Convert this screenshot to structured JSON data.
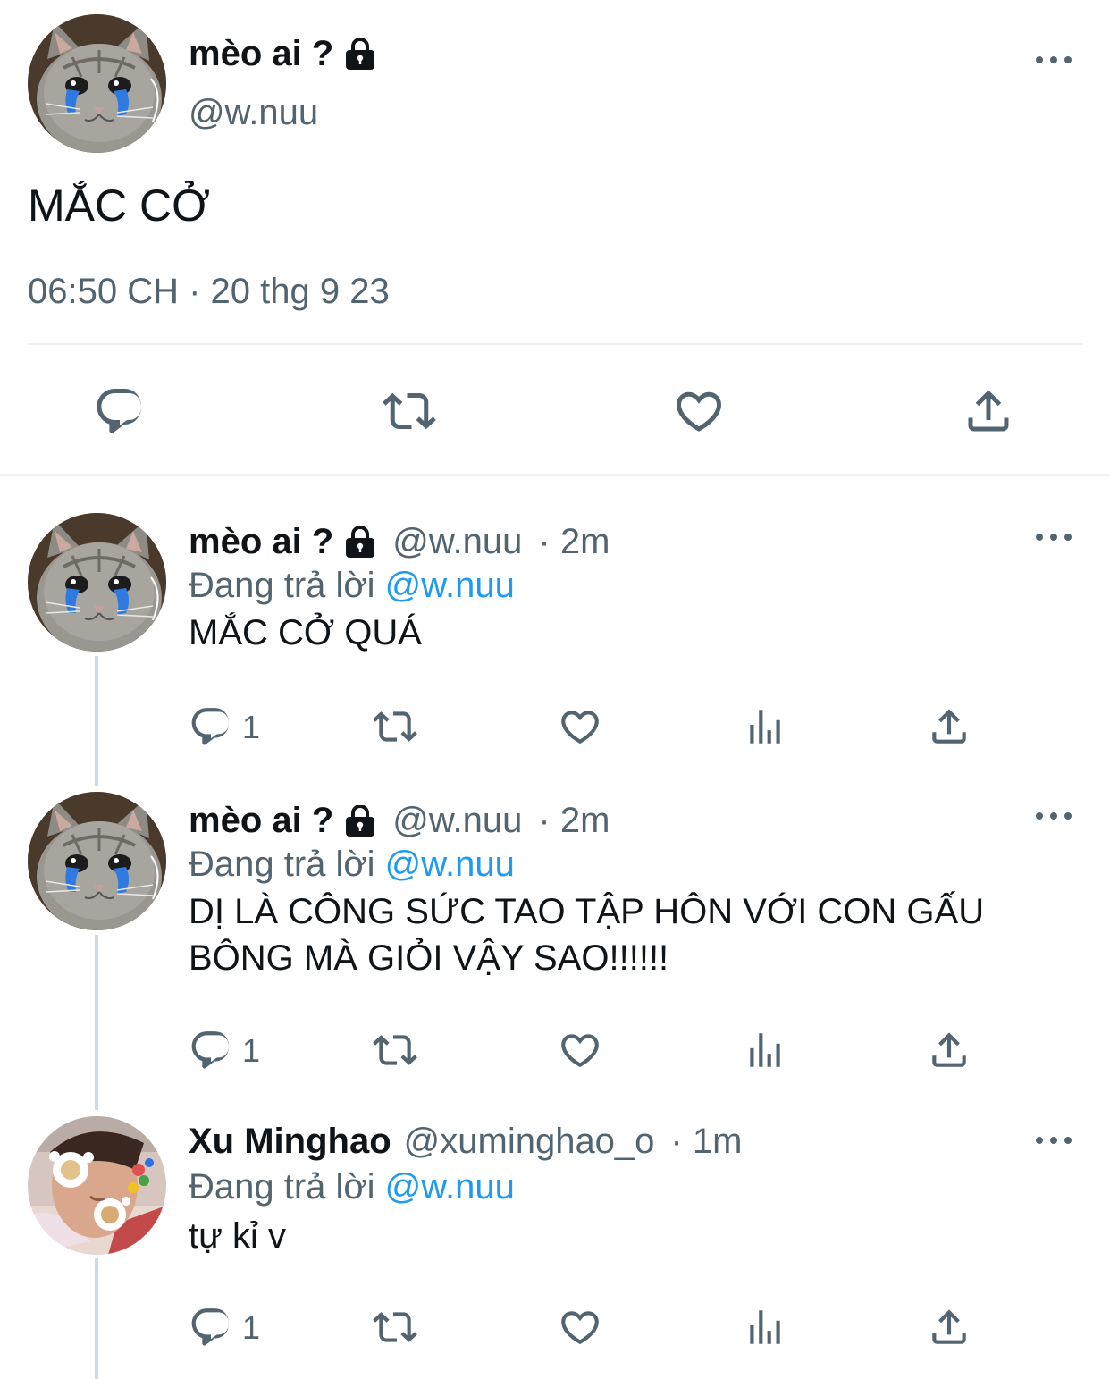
{
  "main_tweet": {
    "display_name": "mèo ai ?",
    "handle": "@w.nuu",
    "text": "MẮC CỞ",
    "timestamp": "06:50 CH · 20 thg 9 23"
  },
  "replies": [
    {
      "display_name": "mèo ai ?",
      "locked": true,
      "handle": "@w.nuu",
      "time": "· 2m",
      "replying_prefix": "Đang trả lời",
      "replying_to": "@w.nuu",
      "text": "MẮC CỞ QUÁ",
      "reply_count": "1",
      "avatar": "crying-cat"
    },
    {
      "display_name": "mèo ai ?",
      "locked": true,
      "handle": "@w.nuu",
      "time": "· 2m",
      "replying_prefix": "Đang trả lời",
      "replying_to": "@w.nuu",
      "text": "DỊ LÀ CÔNG SỨC TAO TẬP HÔN VỚI CON GẤU BÔNG MÀ GIỎI VẬY SAO!!!!!!",
      "reply_count": "1",
      "avatar": "crying-cat"
    },
    {
      "display_name": "Xu Minghao",
      "locked": false,
      "handle": "@xuminghao_o",
      "time": "· 1m",
      "replying_prefix": "Đang trả lời",
      "replying_to": "@w.nuu",
      "text": "tự kỉ v",
      "reply_count": "1",
      "avatar": "person-with-flower-glasses"
    }
  ],
  "icons": {
    "reply": "reply-icon",
    "retweet": "retweet-icon",
    "like": "like-icon",
    "views": "views-icon",
    "share": "share-icon",
    "more": "more-icon",
    "lock": "lock-icon"
  },
  "colors": {
    "text": "#0f1419",
    "secondary": "#536471",
    "link": "#1d9bf0",
    "divider": "#eff3f4",
    "thread_line": "#cfd9de"
  }
}
